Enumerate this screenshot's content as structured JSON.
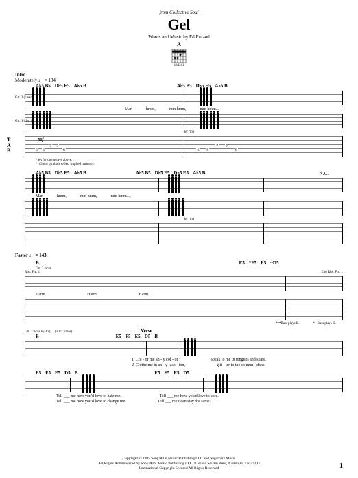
{
  "header": {
    "from": "from Collective Soul",
    "title": "Gel",
    "credits": "Words and Music by Ed Roland",
    "chord_name": "A",
    "chord_fret": "x0",
    "fingering": "134211"
  },
  "intro": {
    "label": "Intro",
    "tempo": "Moderately ♩ = 134",
    "chords_sys1": [
      "A♭5 B5",
      "D♭5 E5",
      "A♭5 B",
      "",
      "A♭5 B5",
      "D♭5 E5",
      "A♭5 B"
    ],
    "gtr2": "Gtr. 2 (clean)",
    "gtr1": "Gtr. 1 (dist.)",
    "mf": "mf",
    "letring": "let ring",
    "lyric1": [
      "Man",
      "hmm,",
      "mm hmm,",
      "mm hmm...,"
    ],
    "foot1": "*Set for one octave above.",
    "foot2": "**Chord symbols reflect implied harmony.",
    "chords_sys2_left": [
      "A♭5 B5",
      "D♭5 E5",
      "A♭5 B"
    ],
    "chords_sys2_right": [
      "A♭5 B5",
      "D♭5 E5",
      "D♭5 E5",
      "A♭5 B"
    ],
    "nc": "N.C.",
    "lyric2a": [
      "Man",
      "hmm,",
      "mm hmm,",
      "mm hmm...,"
    ]
  },
  "faster": {
    "tempo": "Faster ♩ = 143",
    "chord_b": "B",
    "gtr2_tacet": "Gtr. 2 tacet",
    "rhy_fig": "Rhy. Fig. 1",
    "end_rhy": "End Rhy. Fig. 1",
    "chords3": [
      "E5",
      "*F5",
      "E5",
      "~D5"
    ],
    "harms": [
      "Harm.",
      "Harm.",
      "Harm."
    ],
    "bass_note": "***Bass plays E.",
    "star_note": "* ~Bass plays D."
  },
  "verse": {
    "label": "Verse",
    "rhy_note": "Gtr. 1: w/ Rhy. Fig. 1 (3 1/2 times)",
    "chord_b": "B",
    "chords_v": [
      "E5",
      "F5",
      "E5",
      "D5",
      "B"
    ],
    "lyric_v1a": "1. Col - or   me   an - y   col - or.",
    "lyric_v1b": "Speak to   me   in tongues   and    share.",
    "lyric_v2a": "2. Clothe   me   in   an - y   fash - ion,",
    "lyric_v2b": "glit - ter   to   the   so   mun - dane.",
    "chords_v2": [
      "E5",
      "F5",
      "E5",
      "D5",
      "B",
      "E5",
      "F5",
      "E5",
      "D5"
    ],
    "lyric_v3a": "Tell ___   me   how   you'd   love   to   hate   me.",
    "lyric_v3b": "Tell ___   me   how   you'd   love   to   care.",
    "lyric_v4a": "Tell ___   me   how   you'd   love   to   change   me.",
    "lyric_v4b": "Tell ___   me   I   can   stay   the   same."
  },
  "copyright": {
    "line1": "Copyright © 1995 Sony/ATV Music Publishing LLC and Sugartuzz Music",
    "line2": "All Rights Administered by Sony/ATV Music Publishing LLC, 8 Music Square West, Nashville, TN 37203",
    "line3": "International Copyright Secured   All Rights Reserved"
  },
  "pagenum": "1",
  "tab_numbers": {
    "sys1": [
      "6",
      "6",
      "7",
      "7",
      "6",
      "6",
      "6",
      "7",
      "7",
      "6"
    ]
  }
}
